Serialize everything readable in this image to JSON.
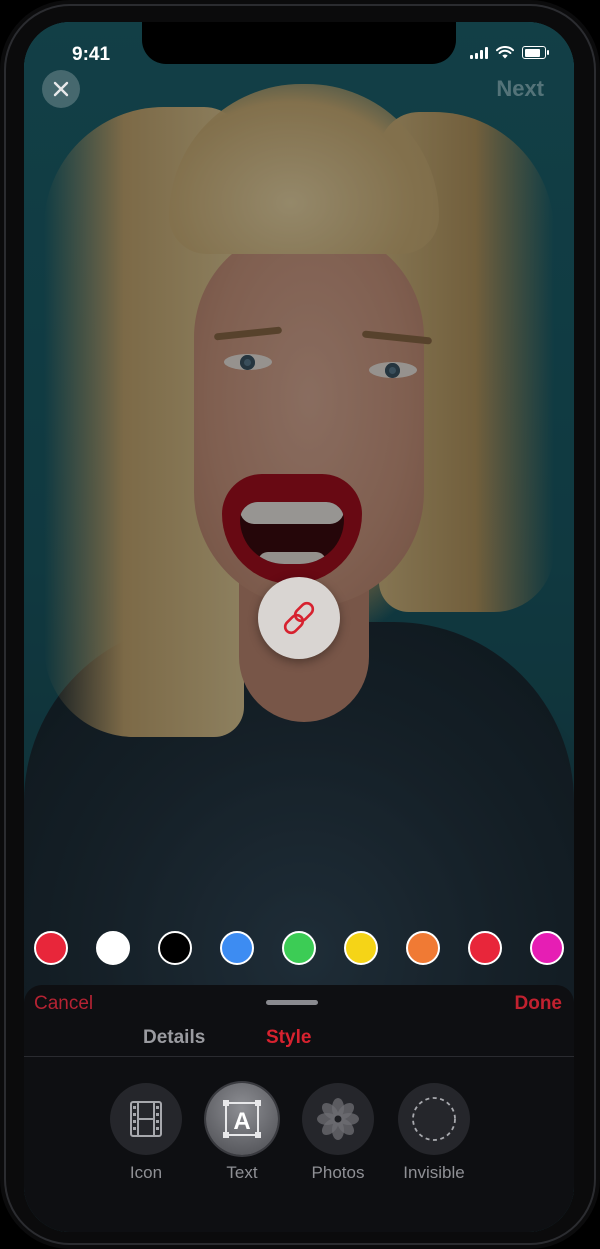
{
  "status_bar": {
    "time": "9:41"
  },
  "top_bar": {
    "next_label": "Next"
  },
  "colors": {
    "accent": "#d7222f",
    "swatches": [
      "#e8263a",
      "#ffffff",
      "#000000",
      "#3d8cf2",
      "#3ccc55",
      "#f5d417",
      "#f07a34",
      "#e8263a",
      "#e61eb4"
    ]
  },
  "sheet": {
    "cancel_label": "Cancel",
    "done_label": "Done",
    "tabs": [
      {
        "label": "Details",
        "selected": false
      },
      {
        "label": "Style",
        "selected": true
      }
    ],
    "options": [
      {
        "label": "Icon",
        "icon": "film-icon",
        "selected": false
      },
      {
        "label": "Text",
        "icon": "text-a-icon",
        "selected": true
      },
      {
        "label": "Photos",
        "icon": "flower-icon",
        "selected": false
      },
      {
        "label": "Invisible",
        "icon": "dashed-circle-icon",
        "selected": false
      }
    ]
  },
  "link_button": {
    "icon": "link-icon"
  }
}
